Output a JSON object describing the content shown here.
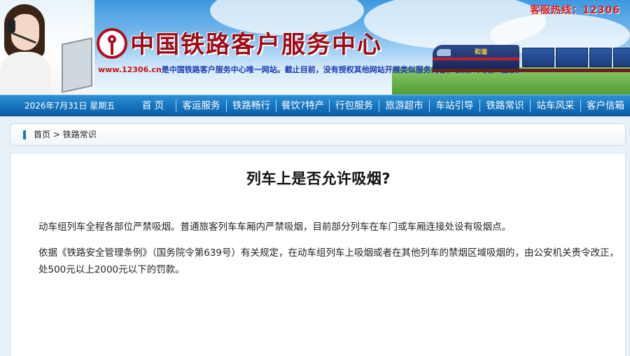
{
  "banner": {
    "site_title": "中国铁路客户服务中心",
    "hotline": "客服热线：12306",
    "notice_url": "www.12306.cn",
    "notice_text": "是中国铁路客户服务中心唯一网站。截止目前，没有授权其他网站开展类似服务内容，敬请广大用户注意。",
    "train_label": "和谐"
  },
  "navbar": {
    "date": "2026年7月31日 星期五",
    "items": [
      "首  页",
      "客运服务",
      "铁路畅行",
      "餐饮?特产",
      "行包服务",
      "旅游超市",
      "车站引导",
      "铁路常识",
      "站车风采",
      "客户信箱"
    ]
  },
  "breadcrumb": {
    "home": "首页",
    "separator": ">",
    "current": "铁路常识"
  },
  "article": {
    "title": "列车上是否允许吸烟?",
    "paragraphs": [
      "动车组列车全程各部位严禁吸烟。普通旅客列车车厢内严禁吸烟，目前部分列车在车门或车厢连接处设有吸烟点。",
      "依据《铁路安全管理条例》（国务院令第639号）有关规定，在动车组列车上吸烟或者在其他列车的禁烟区域吸烟的，由公安机关责令改正，处500元以上2000元以下的罚款。"
    ]
  },
  "colors": {
    "title_red": "#9e0b16",
    "hotline_red": "#d81717",
    "nav_blue": "#1673bd",
    "notice_blue": "#1c38b3"
  }
}
